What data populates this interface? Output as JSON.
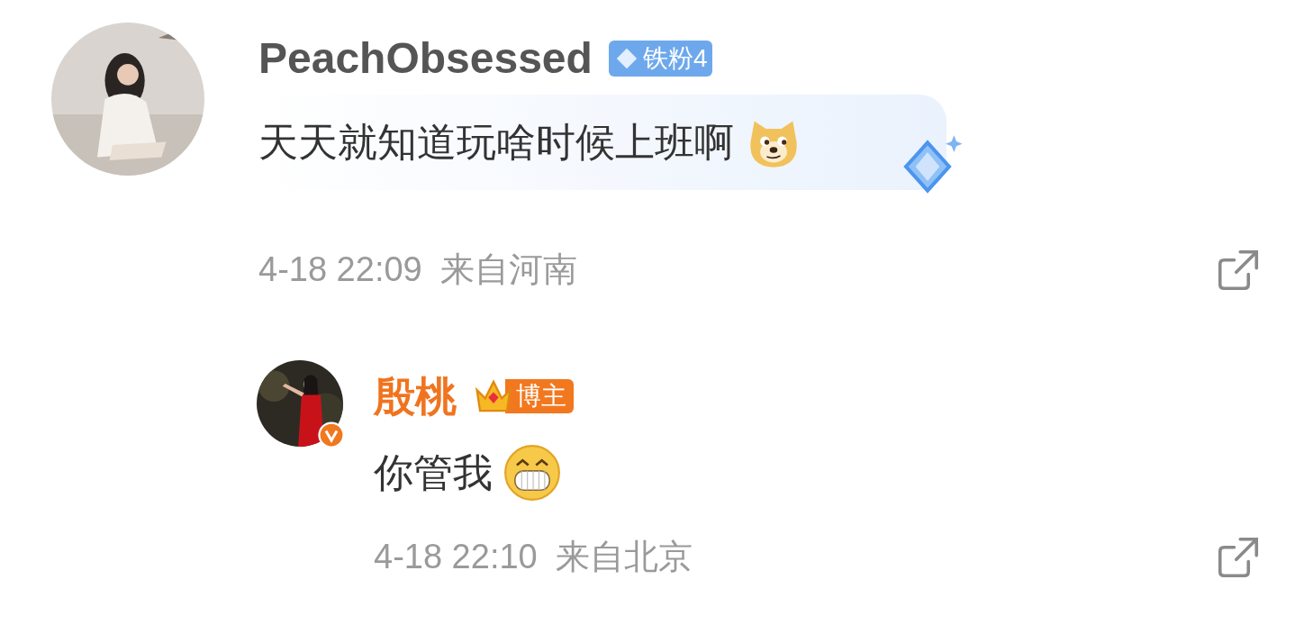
{
  "comments": [
    {
      "kind": "comment",
      "author": "PeachObsessed",
      "badge": {
        "kind": "fan",
        "label": "铁粉4"
      },
      "text": "天天就知道玩啥时候上班啊",
      "emoji": {
        "kind": "doge"
      },
      "verified": false,
      "time": "4-18 22:09",
      "location": "来自河南"
    },
    {
      "kind": "reply",
      "author": "殷桃",
      "badge": {
        "kind": "host",
        "label": "博主"
      },
      "text": "你管我",
      "emoji": {
        "kind": "grin"
      },
      "verified": true,
      "time": "4-18 22:10",
      "location": "来自北京"
    }
  ]
}
